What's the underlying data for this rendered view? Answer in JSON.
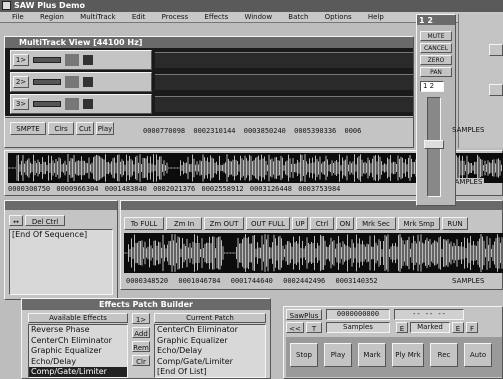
{
  "app": {
    "title": "SAW Plus Demo"
  },
  "menu": [
    "File",
    "Region",
    "MultiTrack",
    "Edit",
    "Process",
    "Effects",
    "Window",
    "Batch",
    "Options",
    "Help"
  ],
  "multitrack": {
    "title": "MultiTrack View [44100 Hz]",
    "tracks": [
      "1>",
      "2>",
      "3>"
    ],
    "ruler": [
      "0000770098",
      "0002310144",
      "0003850240",
      "0005390336",
      "0006"
    ],
    "ruler_unit": "SAMPLES",
    "toolbar": [
      "SMPTE",
      "Clrs",
      "Cut",
      "Play"
    ]
  },
  "overview": {
    "ruler": [
      "0000308750",
      "0000966304",
      "0001483840",
      "0002021376",
      "0002558912",
      "0003126448",
      "0003753984"
    ],
    "ruler_unit": "SAMPLES"
  },
  "sequence": {
    "items": [
      "[End Of Sequence]"
    ],
    "button": "Del Ctrl"
  },
  "edit": {
    "buttons": [
      "To FULL",
      "Zm In",
      "Zm OUT",
      "OUT FULL",
      "UP",
      "Ctrl",
      "ON",
      "Mrk Sec",
      "Mrk Smp",
      "RUN"
    ],
    "ruler": [
      "0000348520",
      "0001046784",
      "0001744640",
      "0002442496",
      "0003140352"
    ],
    "ruler_unit": "SAMPLES"
  },
  "mixer": {
    "buttons": [
      "MUTE",
      "CANCEL",
      "ZERO",
      "PAN"
    ],
    "channel": "1 2"
  },
  "transport": {
    "title": "SawPlus",
    "counter": "0000000000",
    "counter2": "-- -- --",
    "format": "Samples",
    "marker": "Marked",
    "buttons": [
      "Stop",
      "Play",
      "Mark",
      "Ply Mrk",
      "Rec",
      "Auto"
    ],
    "small": [
      "<<",
      "T",
      "E",
      "E",
      "F"
    ]
  },
  "effects": {
    "title": "Effects Patch Builder",
    "left_header": "Available Effects",
    "left_items": [
      "Reverse Phase",
      "CenterCh Eliminator",
      "Graphic Equalizer",
      "Echo/Delay",
      "Comp/Gate/Limiter"
    ],
    "right_header": "Current Patch",
    "right_items": [
      "CenterCh Eliminator",
      "Graphic Equalizer",
      "Echo/Delay",
      "Comp/Gate/Limiter",
      "[End Of List]"
    ],
    "mid_buttons": [
      "1>",
      "Add",
      "Rem",
      "Clr"
    ]
  }
}
